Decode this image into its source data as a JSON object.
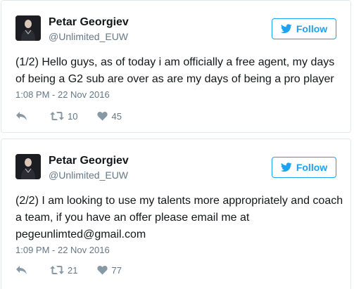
{
  "tweets": [
    {
      "name": "Petar Georgiev",
      "handle": "@Unlimited_EUW",
      "follow_label": "Follow",
      "text": "(1/2) Hello guys, as of today i am officially a free agent, my days of being a G2 sub are over as are my days of being a pro player",
      "timestamp": "1:08 PM - 22 Nov 2016",
      "retweets": "10",
      "likes": "45"
    },
    {
      "name": "Petar Georgiev",
      "handle": "@Unlimited_EUW",
      "follow_label": "Follow",
      "text": "(2/2) I am looking to use my talents more appropriately and coach a team, if you have an offer please email me at pegeunlimted@gmail.com",
      "timestamp": "1:09 PM - 22 Nov 2016",
      "retweets": "21",
      "likes": "77"
    }
  ],
  "icons": {
    "follow": "twitter-bird-icon",
    "reply": "reply-icon",
    "retweet": "retweet-icon",
    "like": "heart-icon"
  },
  "colors": {
    "accent": "#1da1f2",
    "text": "#14171a",
    "muted": "#657786",
    "icon": "#8899a6",
    "border": "#e1e8ed"
  }
}
